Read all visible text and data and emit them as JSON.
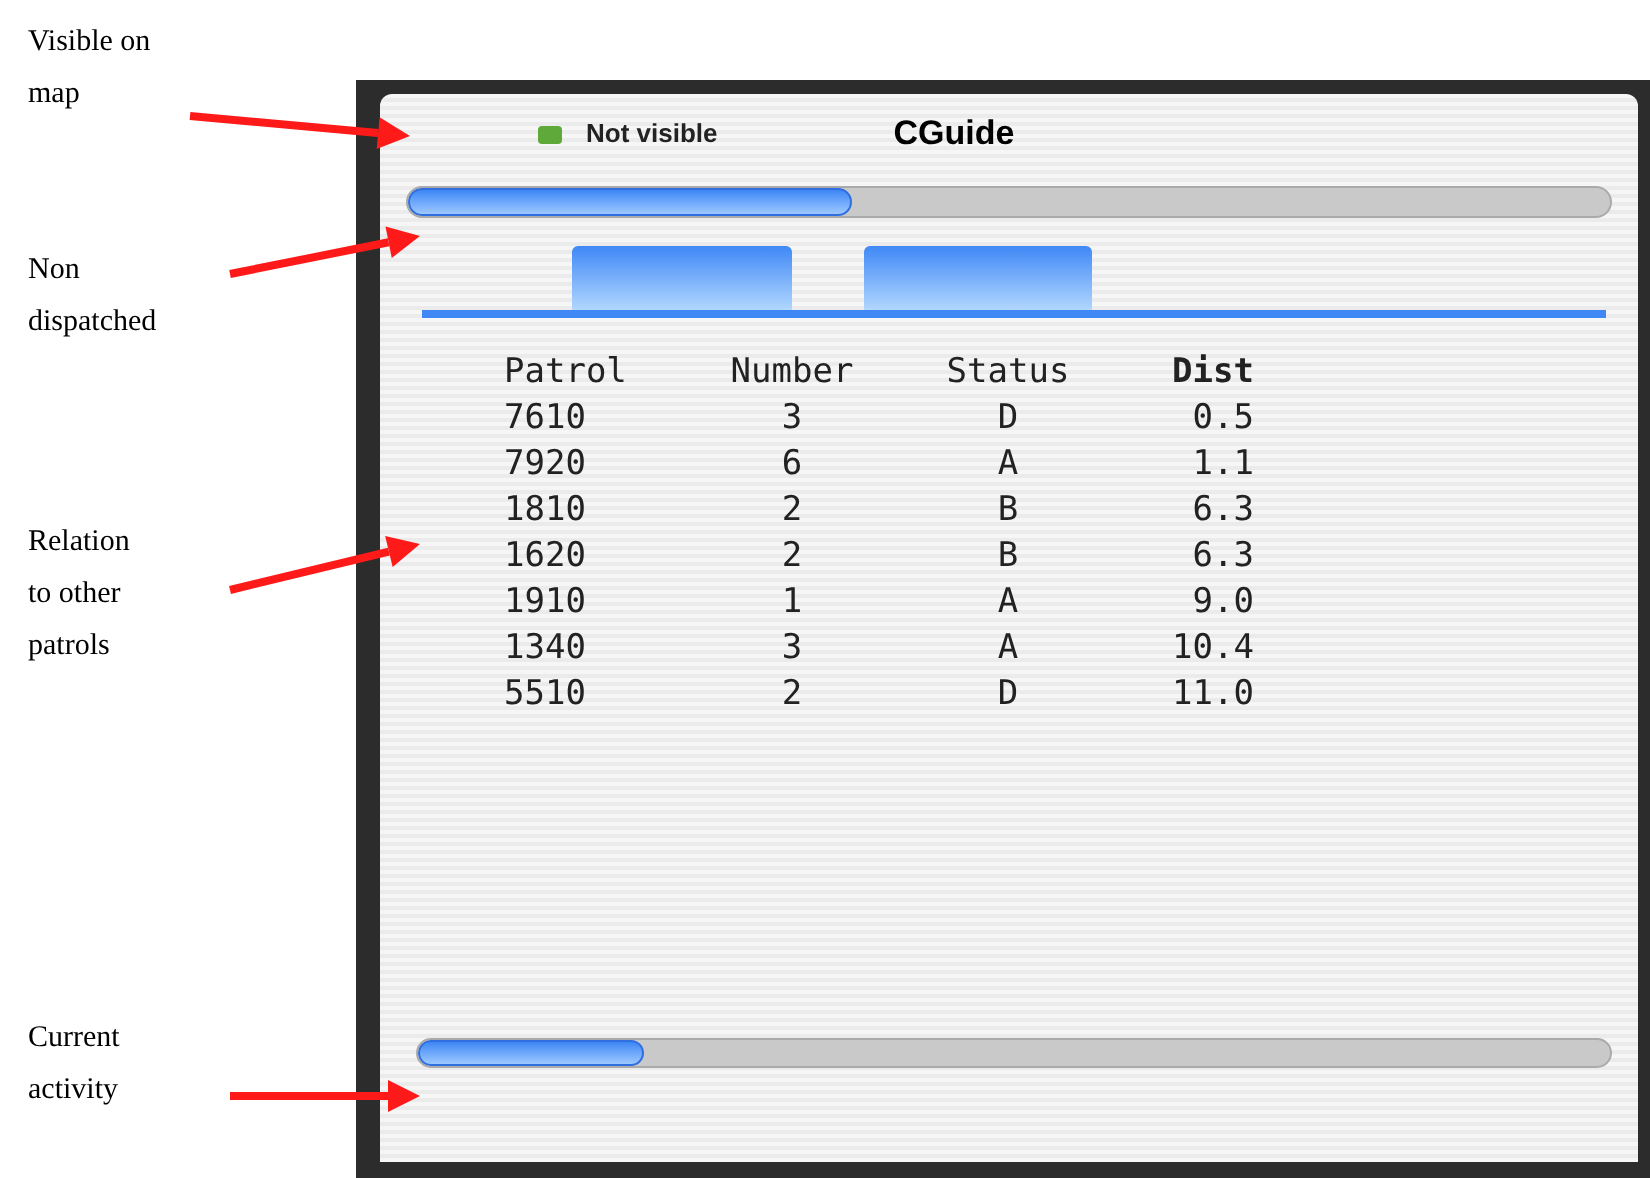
{
  "annotations": [
    {
      "text": "Visible on\nmap"
    },
    {
      "text": "Non\ndispatched"
    },
    {
      "text": "Relation\nto other\npatrols"
    },
    {
      "text": "Current\nactivity"
    }
  ],
  "window": {
    "title": "CGuide"
  },
  "map_visibility": {
    "label": "Not visible"
  },
  "non_dispatched": {
    "level": 0.37
  },
  "table": {
    "columns": [
      "Patrol",
      "Number",
      "Status",
      "Dist"
    ],
    "rows": [
      [
        "7610",
        "3",
        "D",
        "0.5"
      ],
      [
        "7920",
        "6",
        "A",
        "1.1"
      ],
      [
        "1810",
        "2",
        "B",
        "6.3"
      ],
      [
        "1620",
        "2",
        "B",
        "6.3"
      ],
      [
        "1910",
        "1",
        "A",
        "9.0"
      ],
      [
        "1340",
        "3",
        "A",
        "10.4"
      ],
      [
        "5510",
        "2",
        "D",
        "11.0"
      ]
    ]
  },
  "current_activity": {
    "level": 0.19
  }
}
